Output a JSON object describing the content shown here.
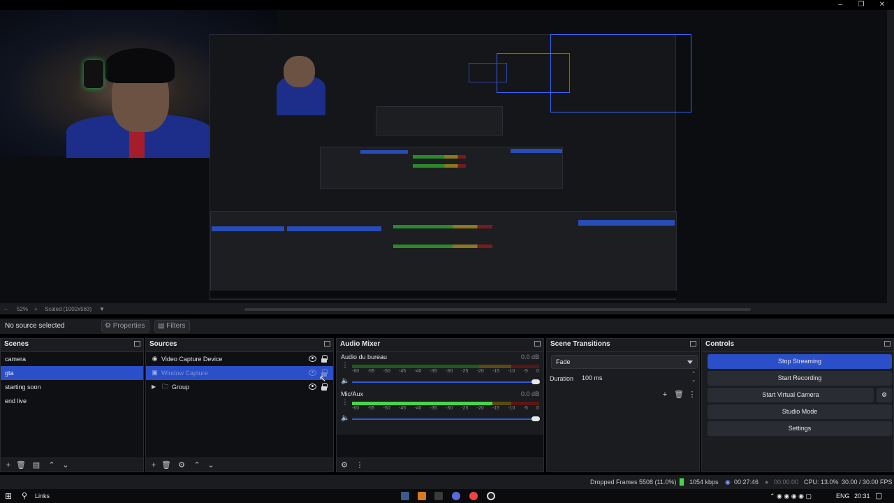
{
  "preview": {
    "zoom": "52%",
    "scale_mode": "Scaled (1002x563)"
  },
  "context": {
    "selection": "No source selected",
    "properties_label": "Properties",
    "filters_label": "Filters"
  },
  "scenes": {
    "title": "Scenes",
    "items": [
      {
        "label": "camera",
        "selected": false
      },
      {
        "label": "gta",
        "selected": true
      },
      {
        "label": "starting soon",
        "selected": false
      },
      {
        "label": "end live",
        "selected": false
      }
    ]
  },
  "sources": {
    "title": "Sources",
    "items": [
      {
        "label": "Video Capture Device",
        "icon": "camera-icon"
      },
      {
        "label": "Window Capture",
        "icon": "window-icon"
      },
      {
        "label": "Group",
        "icon": "folder-icon"
      }
    ]
  },
  "mixer": {
    "title": "Audio Mixer",
    "channels": [
      {
        "name": "Audio du bureau",
        "db": "0.0 dB",
        "level": 0
      },
      {
        "name": "Mic/Aux",
        "db": "0.0 dB",
        "level": 0.75
      }
    ],
    "ticks": [
      "-60",
      "-55",
      "-50",
      "-45",
      "-40",
      "-35",
      "-30",
      "-25",
      "-20",
      "-15",
      "-10",
      "-5",
      "0"
    ]
  },
  "transitions": {
    "title": "Scene Transitions",
    "selected": "Fade",
    "duration_label": "Duration",
    "duration_value": "100 ms"
  },
  "controls": {
    "title": "Controls",
    "stop_streaming": "Stop Streaming",
    "start_recording": "Start Recording",
    "start_virtual_camera": "Start Virtual Camera",
    "studio_mode": "Studio Mode",
    "settings": "Settings"
  },
  "status": {
    "dropped_frames": "Dropped Frames 5508 (11.0%)",
    "bitrate": "1054 kbps",
    "stream_time": "00:27:46",
    "record_time": "00:00:00",
    "cpu": "CPU: 13.0%",
    "fps": "30.00 / 30.00 FPS"
  },
  "taskbar": {
    "search_label": "Links",
    "language": "ENG",
    "time": "20:31"
  },
  "colors": {
    "accent": "#2a4fc8",
    "meter_green": "#47d547",
    "background": "#1b1c20"
  }
}
